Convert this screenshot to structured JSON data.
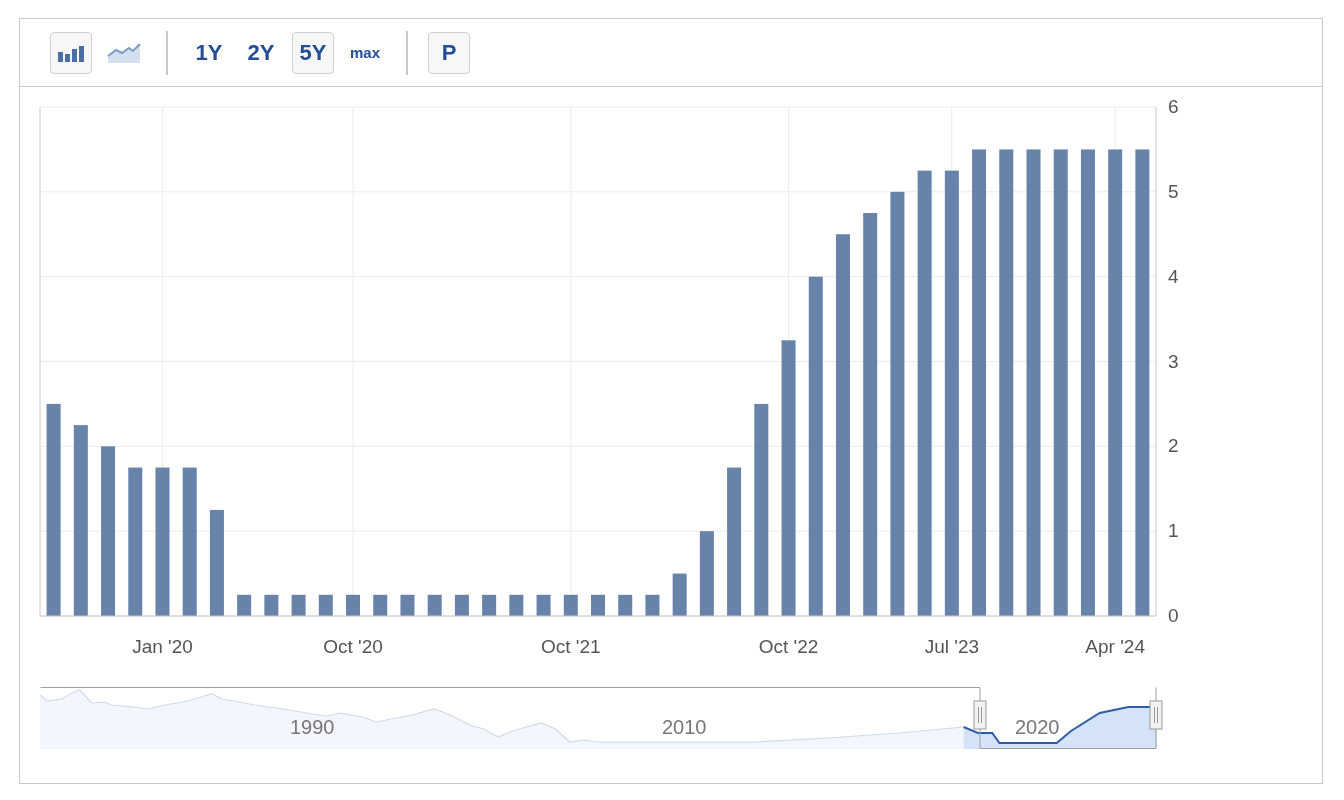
{
  "toolbar": {
    "chart_types": [
      {
        "kind": "bar",
        "selected": true
      },
      {
        "kind": "line",
        "selected": false
      }
    ],
    "ranges": [
      {
        "label": "1Y",
        "selected": false
      },
      {
        "label": "2Y",
        "selected": false
      },
      {
        "label": "5Y",
        "selected": true
      },
      {
        "label": "max",
        "selected": false
      }
    ],
    "p_button": "P"
  },
  "chart_data": {
    "type": "bar",
    "categories": [
      null,
      null,
      null,
      null,
      "Jan '20",
      null,
      null,
      null,
      null,
      null,
      null,
      "Oct '20",
      null,
      null,
      null,
      null,
      null,
      null,
      null,
      "Oct '21",
      null,
      null,
      null,
      null,
      null,
      null,
      null,
      "Oct '22",
      null,
      null,
      null,
      null,
      null,
      "Jul '23",
      null,
      null,
      null,
      null,
      null,
      "Apr '24",
      null
    ],
    "series": [
      {
        "color": "#6783aa",
        "values": [
          2.5,
          2.25,
          2.0,
          1.75,
          1.75,
          1.75,
          1.25,
          0.25,
          0.25,
          0.25,
          0.25,
          0.25,
          0.25,
          0.25,
          0.25,
          0.25,
          0.25,
          0.25,
          0.25,
          0.25,
          0.25,
          0.25,
          0.25,
          0.5,
          1.0,
          1.75,
          2.5,
          3.25,
          4.0,
          4.5,
          4.75,
          5.0,
          5.25,
          5.25,
          5.5,
          5.5,
          5.5,
          5.5,
          5.5,
          5.5,
          5.5
        ]
      }
    ],
    "ylim": [
      0,
      6
    ],
    "yticks": [
      0,
      1,
      2,
      3,
      4,
      5,
      6
    ],
    "grid": true
  },
  "navigator": {
    "labels": [
      "1990",
      "2010",
      "2020"
    ]
  }
}
